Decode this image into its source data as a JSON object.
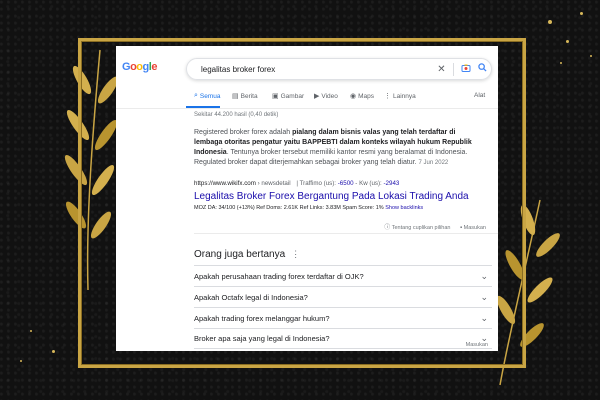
{
  "search": {
    "query": "legalitas broker forex",
    "logo_letters": [
      "G",
      "o",
      "o",
      "g",
      "l",
      "e"
    ]
  },
  "tabs": [
    {
      "label": "Semua",
      "icon": "search-icon",
      "active": true
    },
    {
      "label": "Berita",
      "icon": "news-icon",
      "active": false
    },
    {
      "label": "Gambar",
      "icon": "image-icon",
      "active": false
    },
    {
      "label": "Video",
      "icon": "video-icon",
      "active": false
    },
    {
      "label": "Maps",
      "icon": "map-pin-icon",
      "active": false
    },
    {
      "label": "Lainnya",
      "icon": "more-icon",
      "active": false
    },
    {
      "label": "Alat",
      "icon": "",
      "active": false
    }
  ],
  "result_stats": "Sekitar 44.200 hasil (0,40 detik)",
  "featured": {
    "snippet_pre": "Registered broker forex adalah ",
    "snippet_bold": "pialang dalam bisnis valas yang telah terdaftar di lembaga otoritas pengatur yaitu BAPPEBTI dalam konteks wilayah hukum Republik Indonesia",
    "snippet_post": ". Tentunya broker tersebut memiliki kantor resmi yang beralamat di Indonesia. Regulated broker dapat diterjemahkan sebagai broker yang telah diatur.",
    "date": "7 Jun 2022",
    "cite_url": "https://www.wikifx.com",
    "cite_path": " › newsdetail",
    "cite_extra_1": "| Traffimo (us): ",
    "cite_extra_1_val": "-6500",
    "cite_extra_2": " - Kw (us): ",
    "cite_extra_2_val": "-2943",
    "title": "Legalitas Broker Forex Bergantung Pada Lokasi Trading Anda",
    "moz": "MOZ DA: 34/100 (+13%)   Ref Doms: 2.61K   Ref Links: 3.83M   Spam Score: 1%",
    "moz_link": "Show backlinks",
    "about_label": "Tentang cuplikan pilihan",
    "feedback_label": "Masukan"
  },
  "paa": {
    "title": "Orang juga bertanya",
    "questions": [
      "Apakah perusahaan trading forex terdaftar di OJK?",
      "Apakah Octafx legal di Indonesia?",
      "Apakah trading forex melanggar hukum?",
      "Broker apa saja yang legal di Indonesia?"
    ],
    "feedback_label": "Masukan"
  },
  "colors": {
    "link": "#1a0dab",
    "accent": "#1a73e8",
    "frame_gold": "#c9a544",
    "background": "#111111"
  }
}
